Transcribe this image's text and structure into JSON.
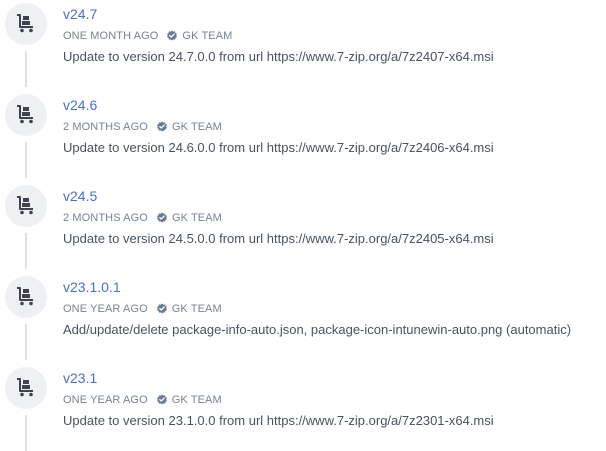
{
  "colors": {
    "link": "#4a72c8",
    "meta_text": "#7a8390",
    "body_text": "#4a5260",
    "icon_bg": "#eef0f3",
    "icon_fg": "#3d4450",
    "connector": "#dfe3e8"
  },
  "entries": [
    {
      "version": "v24.7",
      "age": "ONE MONTH AGO",
      "author": "GK TEAM",
      "description": "Update to version 24.7.0.0 from url https://www.7-zip.org/a/7z2407-x64.msi",
      "icon": "package-cart-icon",
      "author_badge": "verified-badge-icon"
    },
    {
      "version": "v24.6",
      "age": "2 MONTHS AGO",
      "author": "GK TEAM",
      "description": "Update to version 24.6.0.0 from url https://www.7-zip.org/a/7z2406-x64.msi",
      "icon": "package-cart-icon",
      "author_badge": "verified-badge-icon"
    },
    {
      "version": "v24.5",
      "age": "2 MONTHS AGO",
      "author": "GK TEAM",
      "description": "Update to version 24.5.0.0 from url https://www.7-zip.org/a/7z2405-x64.msi",
      "icon": "package-cart-icon",
      "author_badge": "verified-badge-icon"
    },
    {
      "version": "v23.1.0.1",
      "age": "ONE YEAR AGO",
      "author": "GK TEAM",
      "description": "Add/update/delete package-info-auto.json, package-icon-intunewin-auto.png (automatic)",
      "icon": "package-cart-icon",
      "author_badge": "verified-badge-icon"
    },
    {
      "version": "v23.1",
      "age": "ONE YEAR AGO",
      "author": "GK TEAM",
      "description": "Update to version 23.1.0.0 from url https://www.7-zip.org/a/7z2301-x64.msi",
      "icon": "package-cart-icon",
      "author_badge": "verified-badge-icon"
    }
  ]
}
